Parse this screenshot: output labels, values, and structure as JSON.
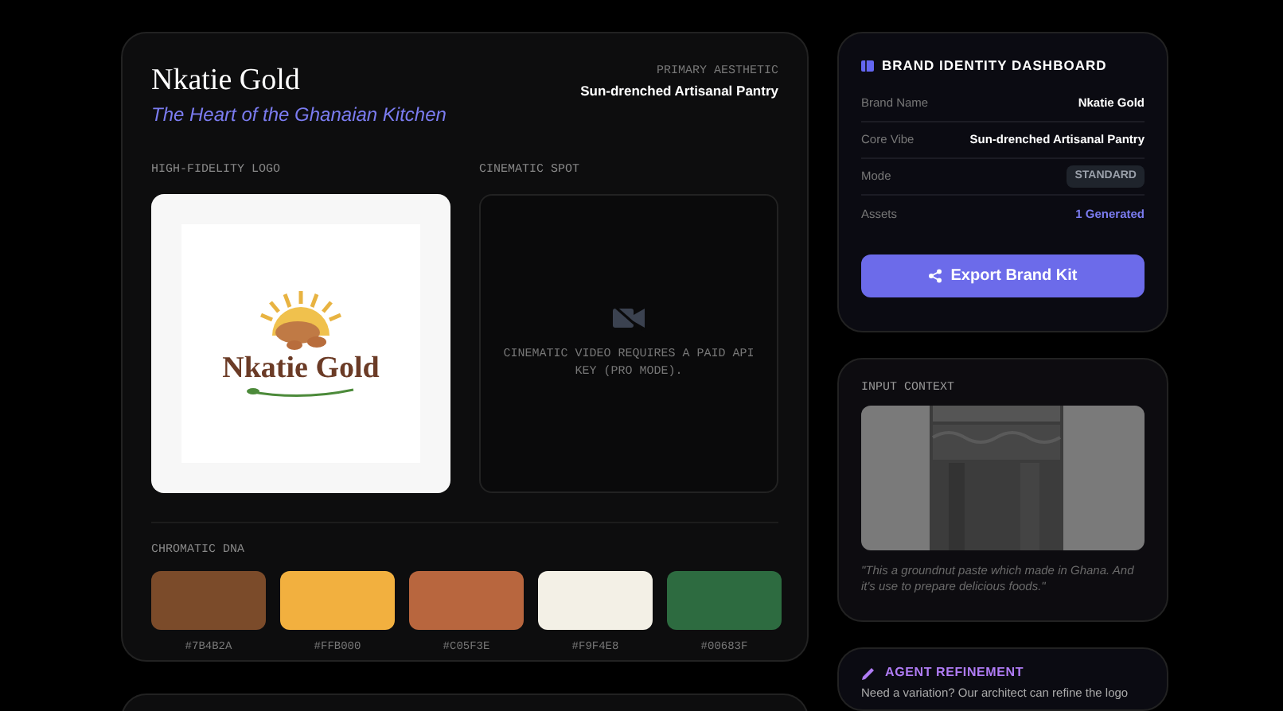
{
  "brand": {
    "name": "Nkatie Gold",
    "tagline": "The Heart of the Ghanaian Kitchen",
    "aesthetic_label": "PRIMARY AESTHETIC",
    "aesthetic": "Sun-drenched Artisanal Pantry"
  },
  "logo_section": {
    "label": "HIGH-FIDELITY LOGO",
    "wordmark": "Nkatie Gold"
  },
  "cinematic_section": {
    "label": "CINEMATIC SPOT",
    "message": "CINEMATIC VIDEO REQUIRES A PAID API KEY (PRO MODE)."
  },
  "palette": {
    "label": "CHROMATIC DNA",
    "swatches": [
      {
        "color": "#7b4b2a",
        "hex": "#7B4B2A"
      },
      {
        "color": "#f2b03f",
        "hex": "#FFB000"
      },
      {
        "color": "#b8663e",
        "hex": "#C05F3E"
      },
      {
        "color": "#f3f0e6",
        "hex": "#F9F4E8"
      },
      {
        "color": "#2d6b40",
        "hex": "#00683F"
      }
    ]
  },
  "dashboard": {
    "title": "BRAND IDENTITY DASHBOARD",
    "rows": [
      {
        "label": "Brand Name",
        "value": "Nkatie Gold",
        "kind": "text"
      },
      {
        "label": "Core Vibe",
        "value": "Sun-drenched Artisanal Pantry",
        "kind": "text"
      },
      {
        "label": "Mode",
        "value": "STANDARD",
        "kind": "badge"
      },
      {
        "label": "Assets",
        "value": "1 Generated",
        "kind": "accent"
      }
    ],
    "button": "Export Brand Kit"
  },
  "input_context": {
    "label": "INPUT CONTEXT",
    "caption": "\"This a groundnut paste which made in Ghana. And it's use to prepare delicious foods.\""
  },
  "agent_refinement": {
    "title": "AGENT REFINEMENT",
    "text": "Need a variation? Our architect can refine the logo"
  }
}
